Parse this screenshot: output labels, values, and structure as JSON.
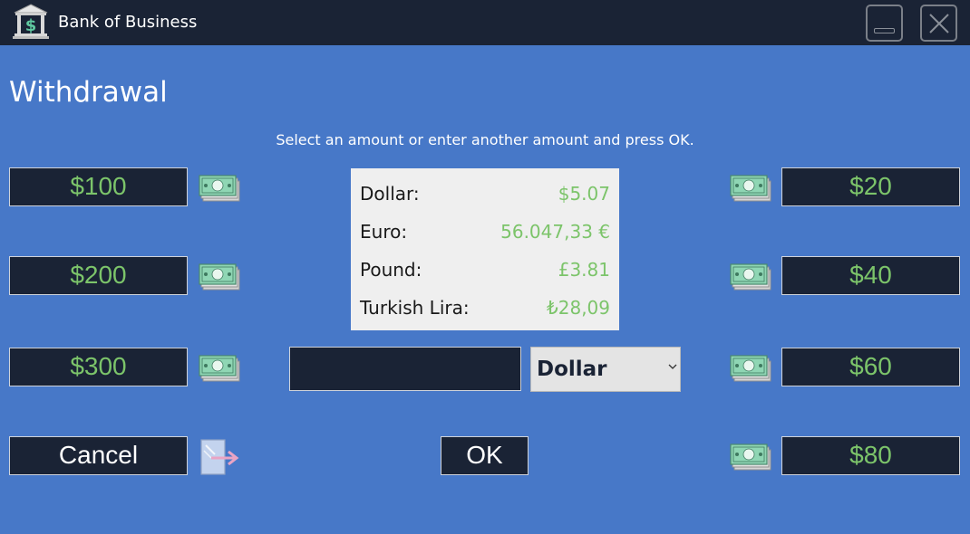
{
  "window": {
    "title": "Bank of Business",
    "logo_icon": "bank-dollar-icon",
    "minimize_icon": "minimize-icon",
    "close_icon": "close-icon"
  },
  "page": {
    "heading": "Withdrawal",
    "instructions": "Select an amount or enter another amount and press OK."
  },
  "amounts_left": [
    "$100",
    "$200",
    "$300"
  ],
  "amounts_right": [
    "$20",
    "$40",
    "$60",
    "$80"
  ],
  "rates": [
    {
      "name": "Dollar:",
      "value": "$5.07"
    },
    {
      "name": "Euro:",
      "value": "56.047,33 €"
    },
    {
      "name": "Pound:",
      "value": "£3.81"
    },
    {
      "name": "Turkish Lira:",
      "value": "₺28,09"
    }
  ],
  "amount_input": {
    "value": ""
  },
  "currency_select": {
    "selected": "Dollar"
  },
  "buttons": {
    "cancel": "Cancel",
    "ok": "OK"
  },
  "icons": {
    "money": "money-stack-icon",
    "exit": "exit-arrow-icon"
  },
  "colors": {
    "background": "#4778c8",
    "dark": "#1a2335",
    "accent_green": "#7cc46a",
    "rates_panel": "#efefef"
  }
}
